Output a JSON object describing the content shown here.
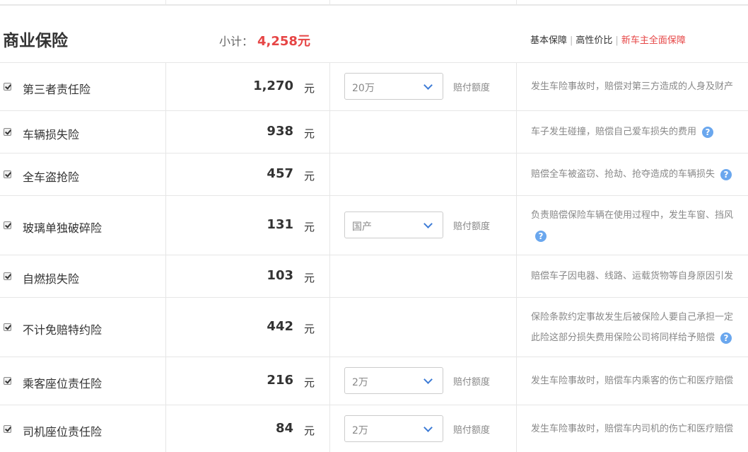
{
  "section": {
    "title": "商业保险",
    "subtotal_label": "小计：",
    "subtotal_value": "4,258元"
  },
  "plans": [
    "基本保障",
    "高性价比",
    "新车主全面保障"
  ],
  "unit": "元",
  "select_label": "赔付额度",
  "colors": {
    "accent_red": "#e64545",
    "help_blue": "#6aa7ee",
    "chevron_blue": "#3d7bd6"
  },
  "rows": [
    {
      "name": "第三者责任险",
      "price": "1,270",
      "checked": true,
      "select": "20万",
      "desc1": "发生车险事故时，赔偿对第三方造成的人身及财产",
      "desc2": ""
    },
    {
      "name": "车辆损失险",
      "price": "938",
      "checked": true,
      "desc1": "车子发生碰撞，赔偿自己爱车损失的费用",
      "desc2": ""
    },
    {
      "name": "全车盗抢险",
      "price": "457",
      "checked": true,
      "desc1": "赔偿全车被盗窃、抢劫、抢夺造成的车辆损失",
      "desc2": ""
    },
    {
      "name": "玻璃单独破碎险",
      "price": "131",
      "checked": true,
      "select": "国产",
      "desc1": "负责赔偿保险车辆在使用过程中，发生车窗、挡风",
      "desc2": ""
    },
    {
      "name": "自燃损失险",
      "price": "103",
      "checked": true,
      "desc1": "赔偿车子因电器、线路、运载货物等自身原因引发",
      "desc2": ""
    },
    {
      "name": "不计免赔特约险",
      "price": "442",
      "checked": true,
      "desc1": "保险条款约定事故发生后被保险人要自己承担一定",
      "desc2": "此险这部分损失费用保险公司将同样给予赔偿"
    },
    {
      "name": "乘客座位责任险",
      "price": "216",
      "checked": true,
      "select": "2万",
      "desc1": "发生车险事故时，赔偿车内乘客的伤亡和医疗赔偿",
      "desc2": ""
    },
    {
      "name": "司机座位责任险",
      "price": "84",
      "checked": true,
      "select": "2万",
      "desc1": "发生车险事故时，赔偿车内司机的伤亡和医疗赔偿",
      "desc2": ""
    }
  ]
}
